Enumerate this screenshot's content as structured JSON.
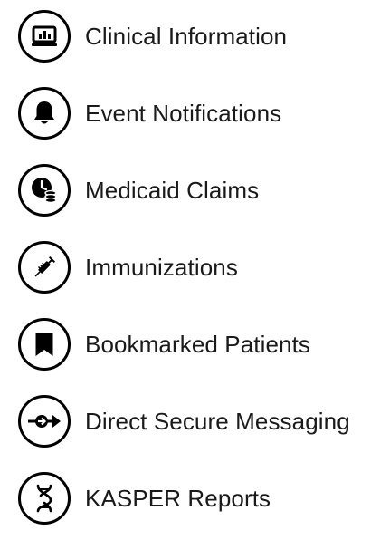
{
  "menu": {
    "items": [
      {
        "label": "Clinical Information",
        "icon": "chart-icon"
      },
      {
        "label": "Event Notifications",
        "icon": "bell-icon"
      },
      {
        "label": "Medicaid Claims",
        "icon": "clock-coins-icon"
      },
      {
        "label": "Immunizations",
        "icon": "syringe-icon"
      },
      {
        "label": "Bookmarked Patients",
        "icon": "bookmark-icon"
      },
      {
        "label": "Direct Secure Messaging",
        "icon": "arrow-send-icon"
      },
      {
        "label": "KASPER Reports",
        "icon": "dna-icon"
      }
    ]
  },
  "colors": {
    "icon_stroke": "#000000",
    "text": "#1a1a1a",
    "background": "#ffffff"
  }
}
